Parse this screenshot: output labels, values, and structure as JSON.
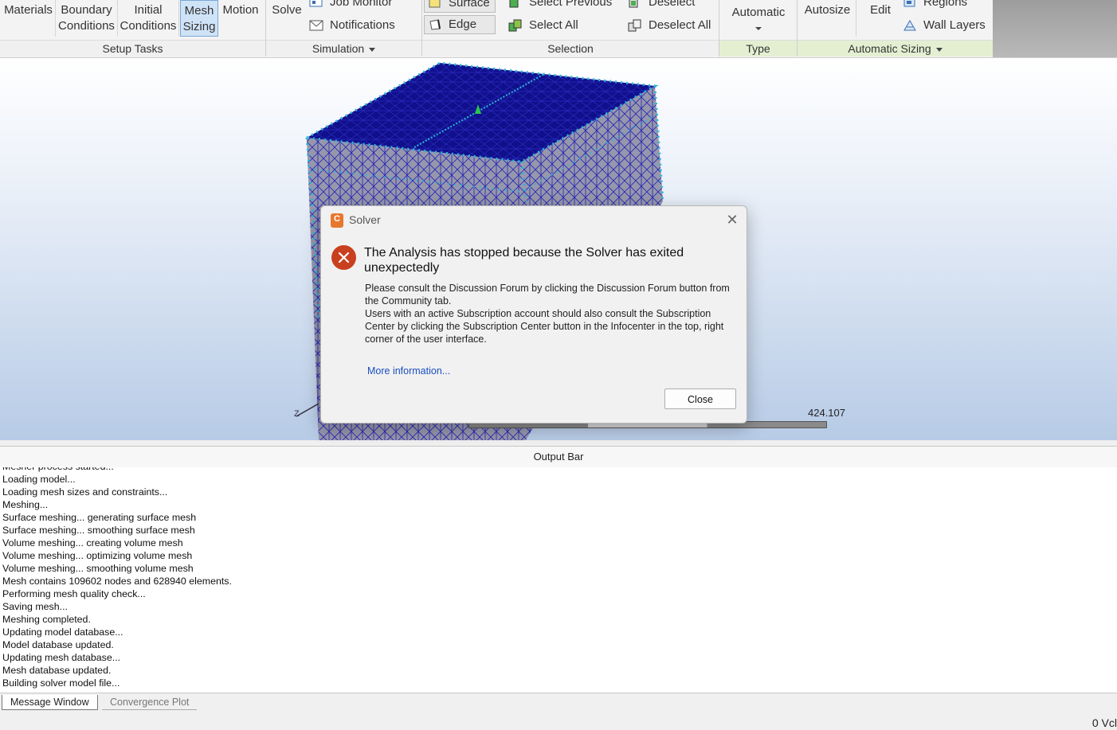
{
  "ribbon": {
    "setup_tasks": {
      "label": "Setup Tasks",
      "materials": "Materials",
      "boundary_line1": "Boundary",
      "boundary_line2": "Conditions",
      "initial_line1": "Initial",
      "initial_line2": "Conditions",
      "mesh_line1": "Mesh",
      "mesh_line2": "Sizing",
      "motion": "Motion"
    },
    "simulation": {
      "label": "Simulation",
      "solve": "Solve",
      "job_monitor": "Job Monitor",
      "notifications": "Notifications"
    },
    "selection": {
      "label": "Selection",
      "surface": "Surface",
      "edge": "Edge",
      "select_previous": "Select Previous",
      "select_all": "Select All",
      "deselect": "Deselect",
      "deselect_all": "Deselect All"
    },
    "type": {
      "label": "Type",
      "automatic": "Automatic"
    },
    "automatic_sizing": {
      "label": "Automatic Sizing",
      "autosize": "Autosize",
      "edit": "Edit",
      "regions": "Regions",
      "wall_layers": "Wall Layers"
    }
  },
  "viewport": {
    "scale_value": "424.107",
    "axis_label": "Z"
  },
  "dialog": {
    "title": "Solver",
    "app_icon_letter": "C",
    "heading": "The Analysis has stopped because the Solver has exited unexpectedly",
    "body_line1": "Please consult the Discussion Forum by clicking the Discussion Forum button from the Community tab.",
    "body_line2": "Users with an active Subscription account should also consult the Subscription Center by clicking the Subscription Center button in the Infocenter in the top, right corner of the user interface.",
    "more_info": "More information...",
    "close_button": "Close"
  },
  "output_bar": {
    "title": "Output Bar"
  },
  "log": {
    "lines": [
      "Mesher process started...",
      "Loading model...",
      "Loading mesh sizes and constraints...",
      "Meshing...",
      "Surface meshing... generating surface mesh",
      "Surface meshing... smoothing surface mesh",
      "Volume meshing... creating volume mesh",
      "Volume meshing... optimizing volume mesh",
      "Volume meshing... smoothing volume mesh",
      "Mesh contains 109602 nodes and 628940 elements.",
      "Performing mesh quality check...",
      "Saving mesh...",
      "Meshing completed.",
      "Updating model database...",
      "Model database updated.",
      "Updating mesh database...",
      "Mesh database updated.",
      "Building solver model file..."
    ]
  },
  "bottom_tabs": {
    "message_window": "Message Window",
    "convergence_plot": "Convergence Plot"
  },
  "status_bar": {
    "text": "0 Vcl"
  },
  "colors": {
    "mesh_top": "#0d0d8c",
    "mesh_side": "#9a9aae",
    "edge_nodes": "#2bb6d6",
    "error_icon": "#c9401f",
    "link": "#1a4ec2",
    "active_tab": "#cfe3f7"
  }
}
